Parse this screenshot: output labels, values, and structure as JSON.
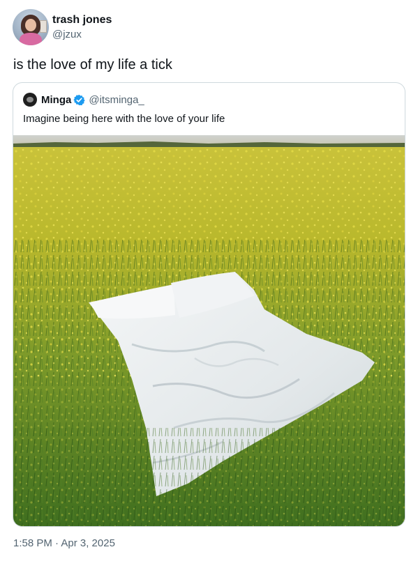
{
  "author": {
    "display_name": "trash jones",
    "handle": "@jzux"
  },
  "tweet": {
    "text": "is the love of my life a tick",
    "timestamp": "1:58 PM · Apr 3, 2025"
  },
  "quoted_tweet": {
    "display_name": "Minga",
    "handle": "@itsminga_",
    "text": "Imagine being here with the love of your life",
    "verified": true
  },
  "colors": {
    "verified_badge": "#1d9bf0",
    "secondary_text": "#536471",
    "border": "#cfd9de"
  },
  "icons": {
    "verified": "verified-badge-icon"
  }
}
